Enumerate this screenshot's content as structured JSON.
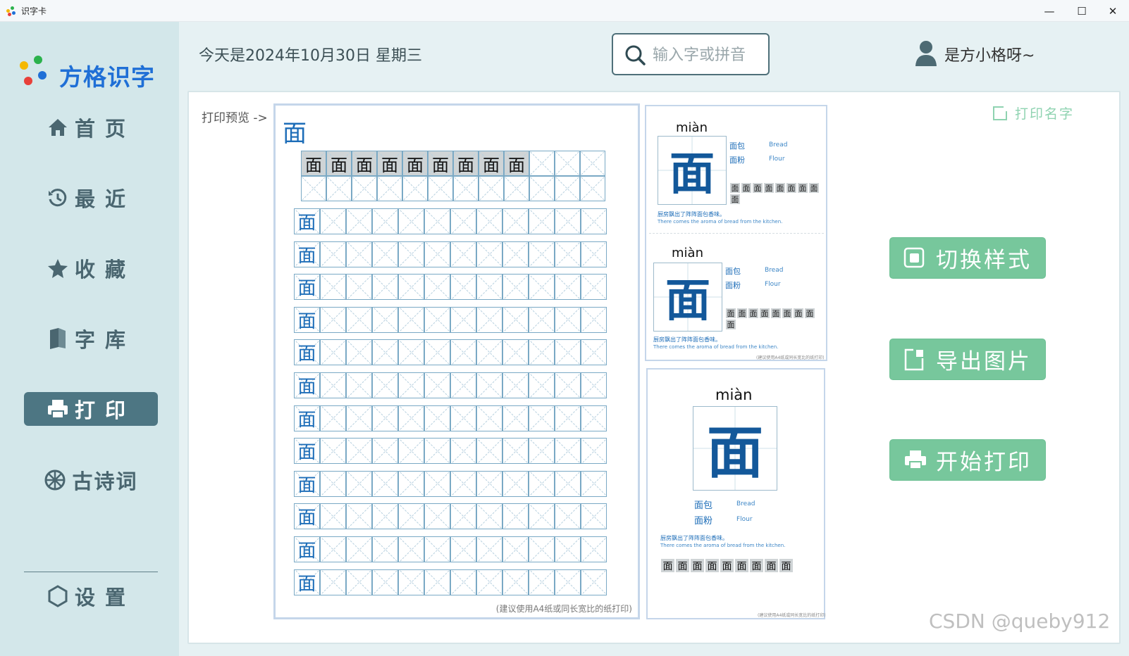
{
  "window": {
    "title": "识字卡",
    "minimize": "—",
    "maximize": "☐",
    "close": "✕"
  },
  "sidebar": {
    "logo": "方格识字",
    "items": [
      {
        "label": "首页",
        "icon": "home-icon"
      },
      {
        "label": "最近",
        "icon": "history-icon"
      },
      {
        "label": "收藏",
        "icon": "star-icon"
      },
      {
        "label": "字库",
        "icon": "book-icon"
      },
      {
        "label": "打印",
        "icon": "printer-icon",
        "active": true
      },
      {
        "label": "古诗词",
        "icon": "wheel-icon"
      }
    ],
    "settings": {
      "label": "设置",
      "icon": "hexagon-icon"
    }
  },
  "header": {
    "date": "今天是2024年10月30日 星期三",
    "search_placeholder": "输入字或拼音",
    "user": "是方小格呀~"
  },
  "main": {
    "preview_label": "打印预览 ->",
    "character": "面",
    "stroke_sequence": [
      "面",
      "面",
      "面",
      "面",
      "面",
      "面",
      "面",
      "面",
      "面"
    ],
    "practice_rows": 12,
    "sheet_note": "(建议使用A4纸或同长宽比的纸打印)",
    "card": {
      "pinyin": "miàn",
      "words": [
        {
          "zh": "面包",
          "en": "Bread"
        },
        {
          "zh": "面粉",
          "en": "Flour"
        }
      ],
      "sentence_zh": "厨房飘出了阵阵面包香味。",
      "sentence_en": "There comes the aroma of bread from the kitchen.",
      "note": "(建议使用A4纸或同长宽比的纸打印)"
    },
    "print_name": "打印名字",
    "buttons": {
      "switch_style": "切换样式",
      "export_image": "导出图片",
      "start_print": "开始打印"
    }
  },
  "watermark": "CSDN @queby912",
  "colors": {
    "accent_green": "#77c79c",
    "nav_active": "#4d7683",
    "sidebar_bg": "#d3e7ea",
    "logo_blue": "#1f6fd6",
    "char_blue": "#13589a"
  }
}
